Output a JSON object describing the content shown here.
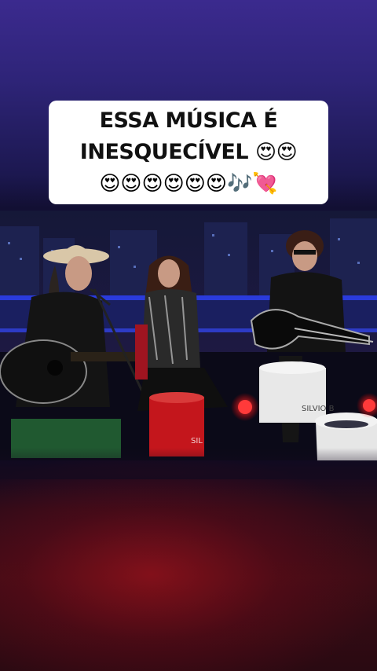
{
  "caption": {
    "line1": "ESSA MÚSICA É",
    "line2_text": "INESQUECÍVEL",
    "line2_emojis": "😍😍",
    "line3_emojis": "😍😍😍😍😍😍🎶💘"
  },
  "video": {
    "stool_text": "SILVIO B",
    "stool_text_left": "SIL"
  },
  "colors": {
    "background_top": "#3b2a8e",
    "caption_bg": "#ffffff",
    "stage_blue": "#2a3bdc",
    "stool_red": "#c4161c"
  },
  "icons": [
    "heart-eyes-emoji",
    "musical-notes-emoji",
    "heart-with-ribbon-emoji"
  ]
}
